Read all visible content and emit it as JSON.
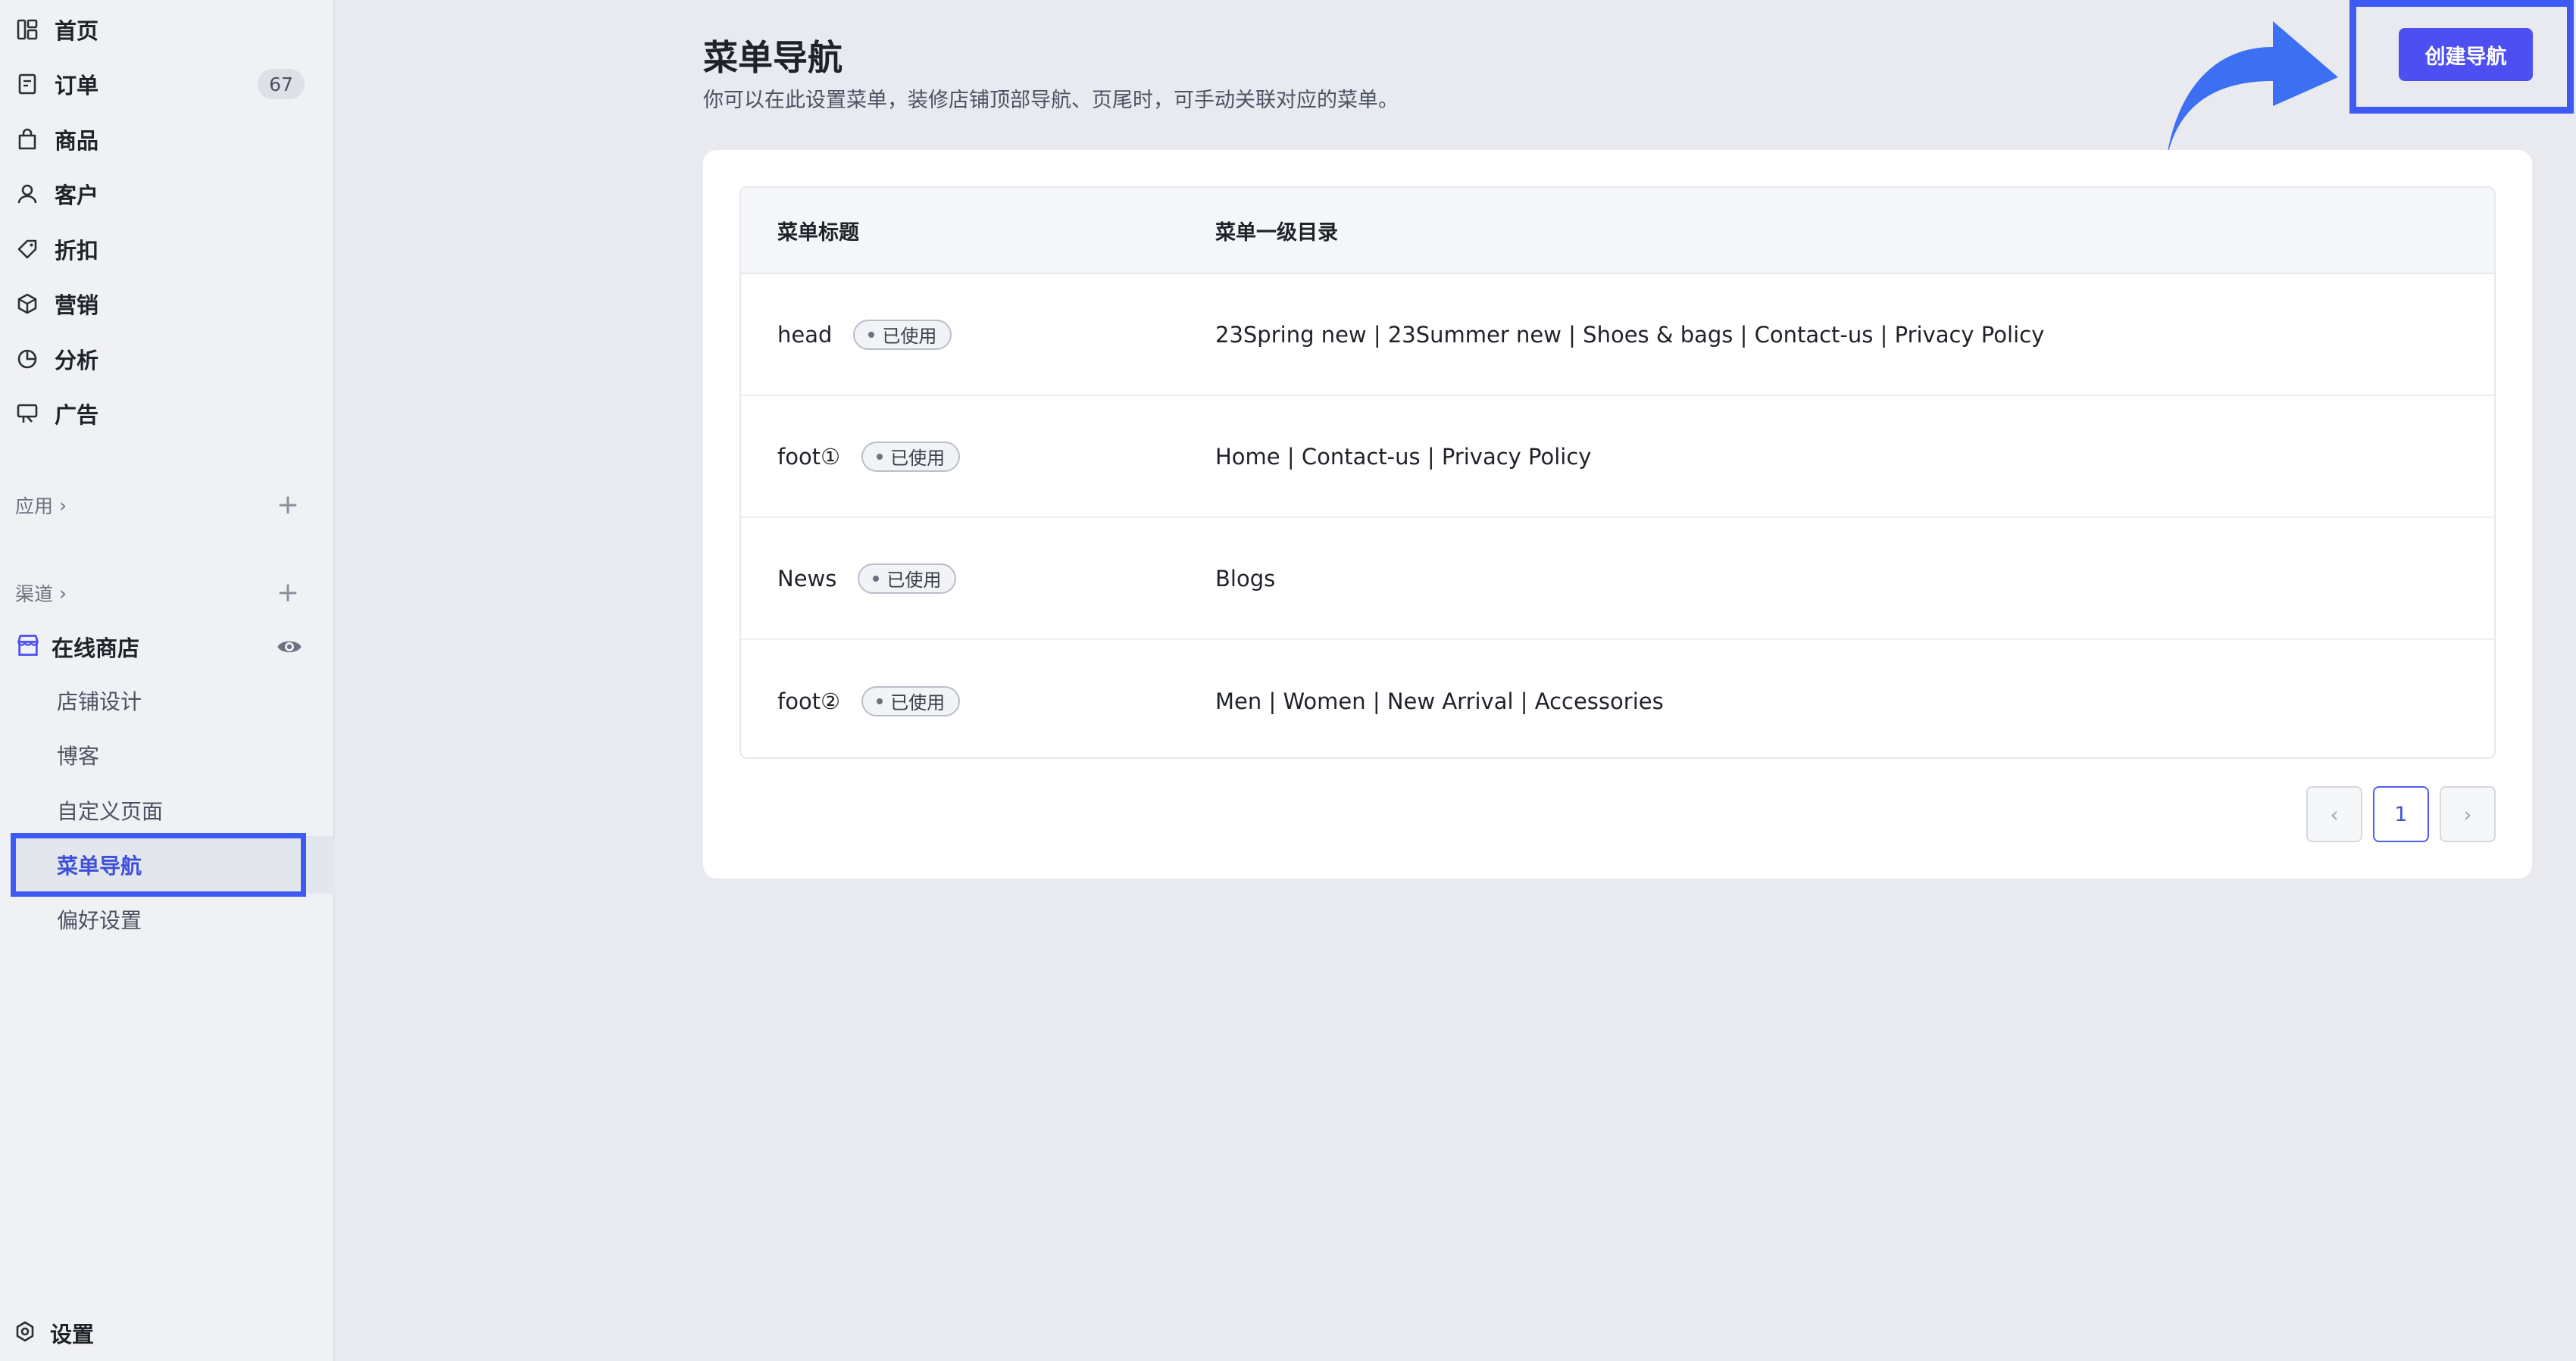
{
  "sidebar": {
    "nav": [
      {
        "label": "首页",
        "icon": "dashboard-icon"
      },
      {
        "label": "订单",
        "icon": "order-icon",
        "count": "67"
      },
      {
        "label": "商品",
        "icon": "bag-icon"
      },
      {
        "label": "客户",
        "icon": "user-icon"
      },
      {
        "label": "折扣",
        "icon": "tag-icon"
      },
      {
        "label": "营销",
        "icon": "cube-icon"
      },
      {
        "label": "分析",
        "icon": "pie-chart-icon"
      },
      {
        "label": "广告",
        "icon": "billboard-icon"
      }
    ],
    "apps_label": "应用",
    "channels_label": "渠道",
    "store": {
      "label": "在线商店",
      "icon": "store-icon"
    },
    "store_sub": [
      {
        "label": "店铺设计"
      },
      {
        "label": "博客"
      },
      {
        "label": "自定义页面"
      },
      {
        "label": "菜单导航",
        "active": true
      },
      {
        "label": "偏好设置"
      }
    ],
    "settings_label": "设置"
  },
  "main": {
    "title": "菜单导航",
    "description": "你可以在此设置菜单，装修店铺顶部导航、页尾时，可手动关联对应的菜单。",
    "create_button": "创建导航",
    "table": {
      "headers": [
        "菜单标题",
        "菜单一级目录"
      ],
      "rows": [
        {
          "title": "head",
          "status": "已使用",
          "directory": "23Spring new | 23Summer new | Shoes & bags | Contact-us | Privacy Policy"
        },
        {
          "title": "foot①",
          "status": "已使用",
          "directory": "Home | Contact-us | Privacy Policy"
        },
        {
          "title": "News",
          "status": "已使用",
          "directory": "Blogs"
        },
        {
          "title": "foot②",
          "status": "已使用",
          "directory": "Men | Women | New Arrival | Accessories"
        }
      ]
    },
    "pagination": {
      "current": "1"
    }
  },
  "colors": {
    "accent": "#4d4ff0",
    "highlight": "#3d5af5"
  }
}
